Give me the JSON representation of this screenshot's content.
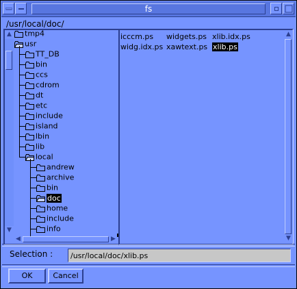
{
  "window": {
    "title": "fs"
  },
  "path": "/usr/local/doc/",
  "tree": {
    "items": [
      {
        "label": "tmp4",
        "depth": 0,
        "open": false
      },
      {
        "label": "usr",
        "depth": 0,
        "open": true
      },
      {
        "label": "TT_DB",
        "depth": 1,
        "open": false
      },
      {
        "label": "bin",
        "depth": 1,
        "open": false
      },
      {
        "label": "ccs",
        "depth": 1,
        "open": false
      },
      {
        "label": "cdrom",
        "depth": 1,
        "open": false
      },
      {
        "label": "dt",
        "depth": 1,
        "open": false
      },
      {
        "label": "etc",
        "depth": 1,
        "open": false
      },
      {
        "label": "include",
        "depth": 1,
        "open": false
      },
      {
        "label": "island",
        "depth": 1,
        "open": false
      },
      {
        "label": "lbin",
        "depth": 1,
        "open": false
      },
      {
        "label": "lib",
        "depth": 1,
        "open": false
      },
      {
        "label": "local",
        "depth": 1,
        "open": true
      },
      {
        "label": "andrew",
        "depth": 2,
        "open": false
      },
      {
        "label": "archive",
        "depth": 2,
        "open": false
      },
      {
        "label": "bin",
        "depth": 2,
        "open": false
      },
      {
        "label": "doc",
        "depth": 2,
        "open": true,
        "selected": true
      },
      {
        "label": "home",
        "depth": 2,
        "open": false
      },
      {
        "label": "include",
        "depth": 2,
        "open": false
      },
      {
        "label": "info",
        "depth": 2,
        "open": false
      }
    ]
  },
  "files": [
    {
      "name": "icccm.ps",
      "selected": false
    },
    {
      "name": "widgets.ps",
      "selected": false
    },
    {
      "name": "xlib.idx.ps",
      "selected": false
    },
    {
      "name": "widg.idx.ps",
      "selected": false
    },
    {
      "name": "xawtext.ps",
      "selected": false
    },
    {
      "name": "xlib.ps",
      "selected": true
    }
  ],
  "selection": {
    "label": "Selection :",
    "value": "/usr/local/doc/xlib.ps"
  },
  "buttons": {
    "ok": "OK",
    "cancel": "Cancel"
  },
  "icons": {
    "folder": "folder-icon",
    "open_folder": "open-folder-icon"
  }
}
